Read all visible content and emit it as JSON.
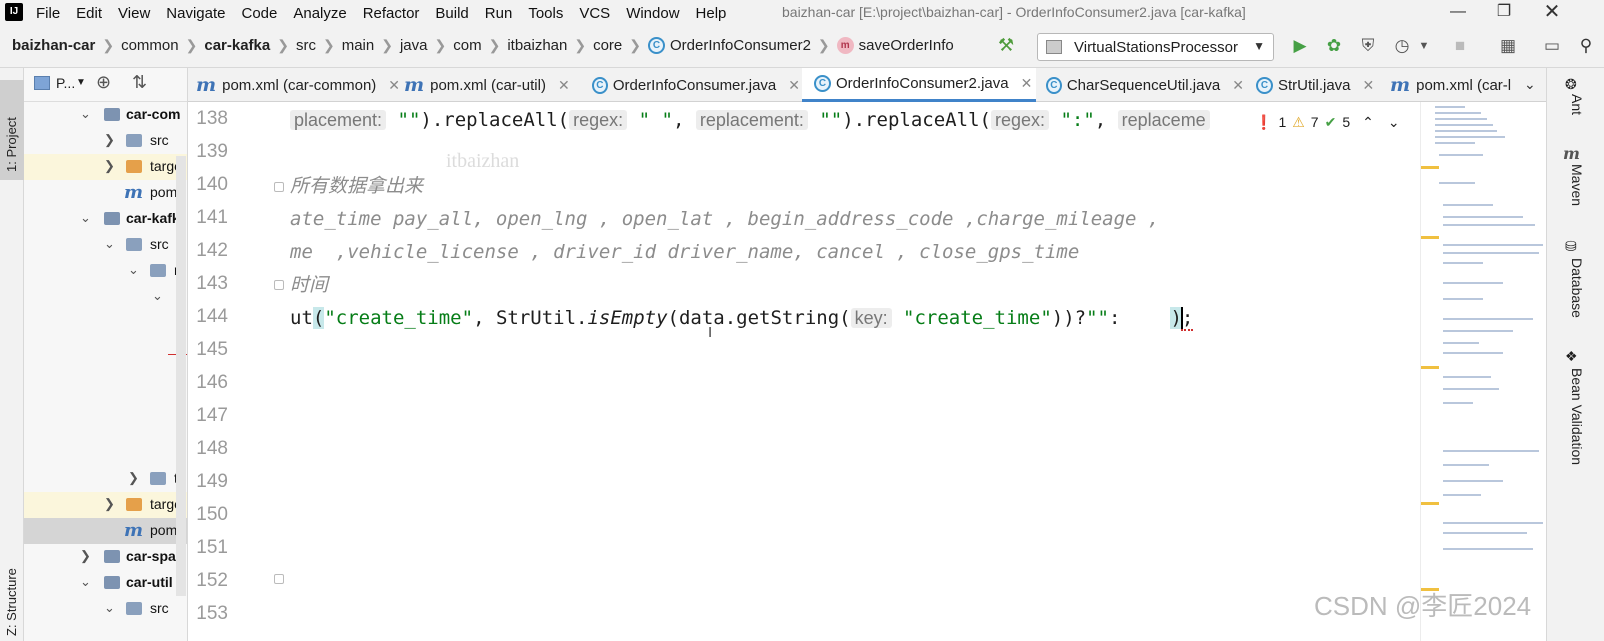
{
  "menubar": {
    "logo": "IJ",
    "items": [
      "File",
      "Edit",
      "View",
      "Navigate",
      "Code",
      "Analyze",
      "Refactor",
      "Build",
      "Run",
      "Tools",
      "VCS",
      "Window",
      "Help"
    ],
    "window_title": "baizhan-car [E:\\project\\baizhan-car] - OrderInfoConsumer2.java [car-kafka]"
  },
  "breadcrumbs": {
    "items": [
      "baizhan-car",
      "common",
      "car-kafka",
      "src",
      "main",
      "java",
      "com",
      "itbaizhan",
      "core",
      "OrderInfoConsumer2",
      "saveOrderInfo"
    ]
  },
  "toolbar": {
    "run_config": "VirtualStationsProcessor"
  },
  "left_stripe": {
    "project": "1: Project",
    "structure": "Z: Structure"
  },
  "project_panel": {
    "title": "P...",
    "rows": [
      {
        "label": "car-com"
      },
      {
        "label": "src"
      },
      {
        "label": "targe"
      },
      {
        "label": "pom."
      },
      {
        "label": "car-kafk"
      },
      {
        "label": "src"
      },
      {
        "label": "m"
      },
      {
        "label": "te"
      },
      {
        "label": "targe"
      },
      {
        "label": "pom."
      },
      {
        "label": "car-spar"
      },
      {
        "label": "car-util"
      },
      {
        "label": "src"
      }
    ]
  },
  "tabs": [
    {
      "label": "pom.xml (car-common)"
    },
    {
      "label": "pom.xml (car-util)"
    },
    {
      "label": "OrderInfoConsumer.java"
    },
    {
      "label": "OrderInfoConsumer2.java"
    },
    {
      "label": "CharSequenceUtil.java"
    },
    {
      "label": "StrUtil.java"
    },
    {
      "label": "pom.xml (car-l"
    }
  ],
  "editor": {
    "line_numbers": [
      "138",
      "139",
      "140",
      "141",
      "142",
      "143",
      "144",
      "145",
      "146",
      "147",
      "148",
      "149",
      "150",
      "151",
      "152",
      "153"
    ],
    "l138_a": "placement:",
    "l138_b": "\"\"",
    "l138_c": ").replaceAll(",
    "l138_d": "regex:",
    "l138_e": "\" \"",
    "l138_f": ", ",
    "l138_g": "replacement:",
    "l138_h": "\"\"",
    "l138_i": ").replaceAll(",
    "l138_j": "regex:",
    "l138_k": "\":\"",
    "l138_l": ", ",
    "l138_m": "replaceme",
    "l140": "所有数据拿出来",
    "l141": "ate_time pay_all, open_lng , open_lat , begin_address_code ,charge_mileage ,",
    "l142": "me  ,vehicle_license , driver_id driver_name, cancel , close_gps_time",
    "l143": "时间",
    "l144_a": "ut",
    "l144_b": "(",
    "l144_c": "\"create_time\"",
    "l144_d": ", StrUtil.",
    "l144_e": "isEmpty",
    "l144_f": "(",
    "l144_g": "data.getString(",
    "l144_h": "key:",
    "l144_i": "\"create_time\"",
    "l144_j": "))?",
    "l144_k": "\"\"",
    "l144_l": ":",
    "l144_m": ")",
    "l144_n": ";",
    "watermark": "itbaizhan"
  },
  "inspections": {
    "errors": "1",
    "warnings": "7",
    "weak": "5"
  },
  "right_stripe": {
    "ant": "Ant",
    "maven": "Maven",
    "database": "Database",
    "bean": "Bean Validation"
  },
  "watermark_csdn": "CSDN @李匠2024"
}
